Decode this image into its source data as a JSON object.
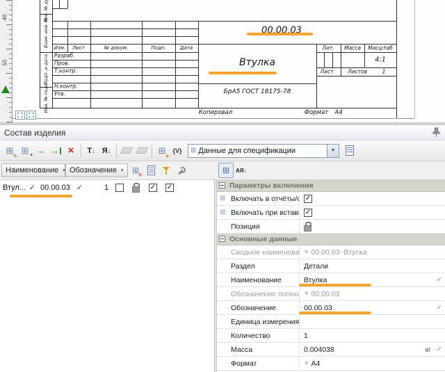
{
  "drawing": {
    "ruler_labels": [
      "40",
      "50"
    ],
    "side_labels": [
      "Инв. № дубл.",
      "Взам. инв. №",
      "Подп. и дата",
      "Инв. № подл."
    ],
    "title_block": {
      "designation": "00.00.03",
      "name": "Втулка",
      "material": "БрА5 ГОСТ 18175-78",
      "scale_value": "4:1",
      "sheets_value": "1",
      "col_izm": "Изм.",
      "col_list": "Лист",
      "col_doc": "№ докум.",
      "col_podp": "Подп.",
      "col_data": "Дата",
      "role_razrab": "Разраб.",
      "role_prov": "Пров.",
      "role_tkontr": "Т.контр.",
      "role_nkontr": "Н.контр.",
      "role_utv": "Утв.",
      "hdr_lit": "Лит.",
      "hdr_massa": "Масса",
      "hdr_masshtab": "Масштаб",
      "lbl_list": "Лист",
      "lbl_listov": "Листов",
      "footer_copy": "Копировал",
      "footer_format": "Формат",
      "footer_format_value": "А4"
    }
  },
  "panel": {
    "title": "Состав изделия",
    "toolbar": {
      "combo_value": "Данные для спецификации",
      "sort1": "Т",
      "sort2": "Я",
      "vars": "{V}",
      "az": "АЯ"
    },
    "list": {
      "header_name": "Наименование",
      "header_designation": "Обозначение",
      "row": {
        "name": "Втул...",
        "designation": "00.00.03",
        "qty": "1"
      }
    },
    "props": {
      "section1": "Параметры включения",
      "section2": "Основные данные",
      "rows": [
        {
          "label": "Включать в отчёты/с",
          "value": ""
        },
        {
          "label": "Включать при вставк",
          "value": ""
        },
        {
          "label": "Позиция",
          "value": ""
        },
        {
          "label": "Сводное наименование",
          "value": "00.00.03~Втулка"
        },
        {
          "label": "Раздел",
          "value": "Детали"
        },
        {
          "label": "Наименование",
          "value": "Втулка"
        },
        {
          "label": "Обозначение полное",
          "value": "00.00.03"
        },
        {
          "label": "Обозначение",
          "value": "00.00.03"
        },
        {
          "label": "Единица измерения",
          "value": ""
        },
        {
          "label": "Количество",
          "value": "1"
        },
        {
          "label": "Масса",
          "value": "0.004038",
          "unit": "кг"
        },
        {
          "label": "Формат",
          "value": "А4"
        }
      ]
    }
  },
  "glyphs": {
    "check": "✓",
    "dropdown": "▼",
    "menu_arrow": "▾",
    "grid": "⊞",
    "snowflake": "✳",
    "arrow": "→",
    "cross": "×",
    "pencil": "✎",
    "star": "★",
    "dot": "•",
    "down": "↓"
  }
}
